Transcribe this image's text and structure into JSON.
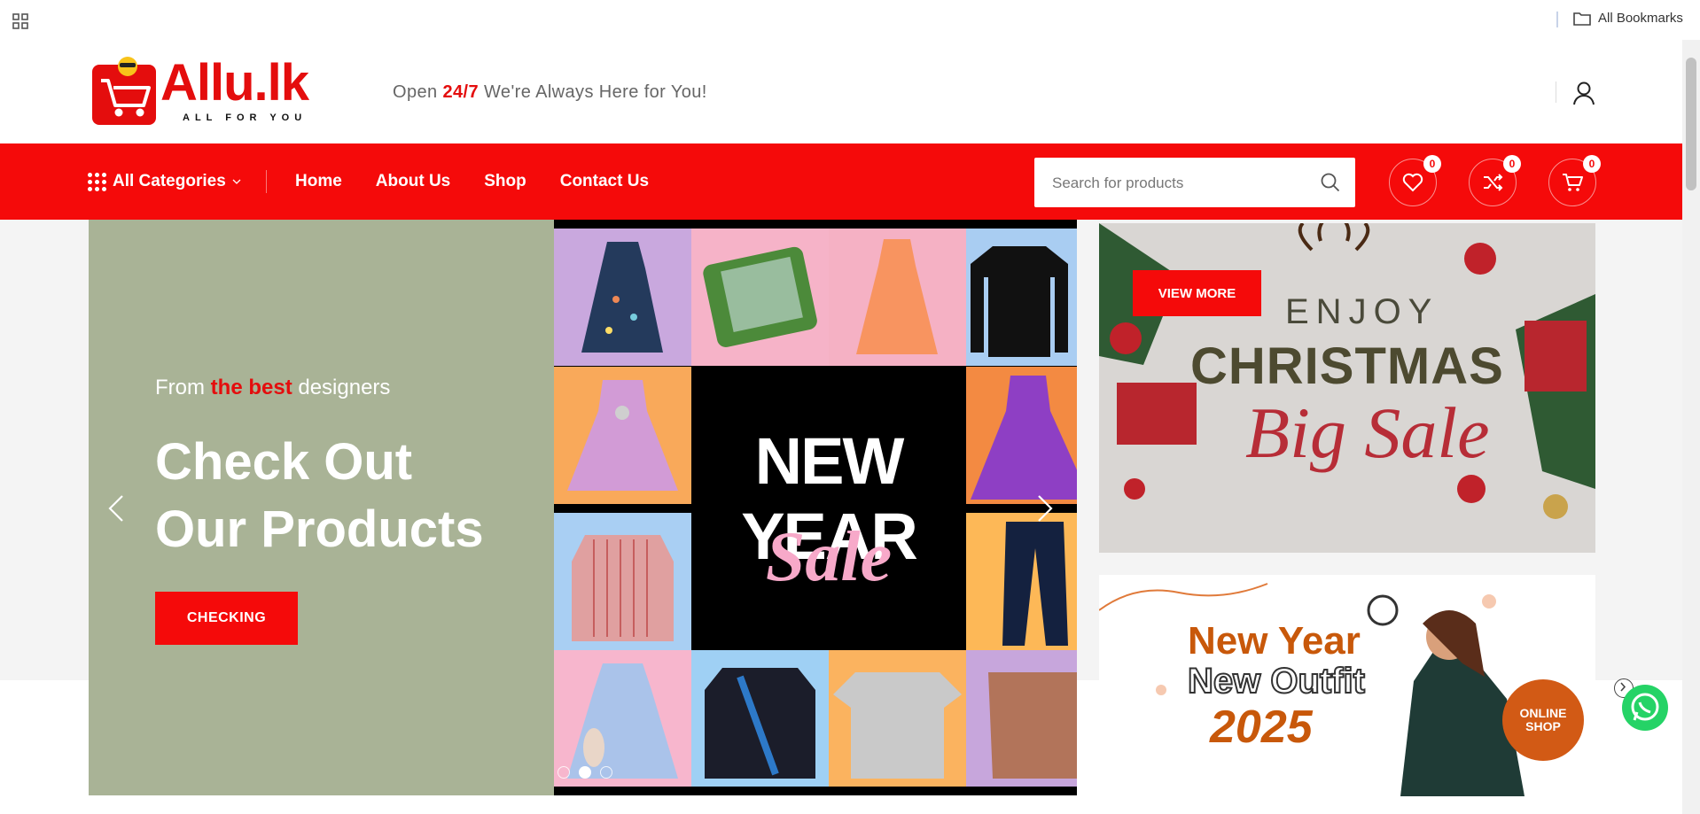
{
  "bookmarks_bar": {
    "all_bookmarks_label": "All Bookmarks"
  },
  "logo": {
    "brand": "Allu.lk",
    "tagline": "ALL FOR YOU"
  },
  "header": {
    "tagline_prefix": "Open",
    "tagline_highlight": "24/7",
    "tagline_suffix": "We're Always Here for You!"
  },
  "nav": {
    "all_categories": "All Categories",
    "menu": [
      "Home",
      "About Us",
      "Shop",
      "Contact Us"
    ]
  },
  "search": {
    "placeholder": "Search for products"
  },
  "header_actions": {
    "wishlist_count": "0",
    "compare_count": "0",
    "cart_count": "0"
  },
  "hero": {
    "subtitle_prefix": "From",
    "subtitle_highlight": "the best",
    "subtitle_suffix": "designers",
    "title_line1": "Check Out",
    "title_line2": "Our Products",
    "button": "CHECKING",
    "collage_title": "NEW YEAR",
    "collage_sale": "Sale",
    "active_slide": 2,
    "slide_count": 3
  },
  "promo_christmas": {
    "button": "VIEW MORE",
    "line1": "ENJOY",
    "line2": "CHRISTMAS",
    "line3": "Big Sale"
  },
  "promo_newyear": {
    "line1": "New Year",
    "line2": "New Outfit",
    "line3": "2025",
    "badge": "ONLINE SHOP"
  },
  "colors": {
    "brand_red": "#f50a0a",
    "slide_bg": "#a9b396"
  }
}
